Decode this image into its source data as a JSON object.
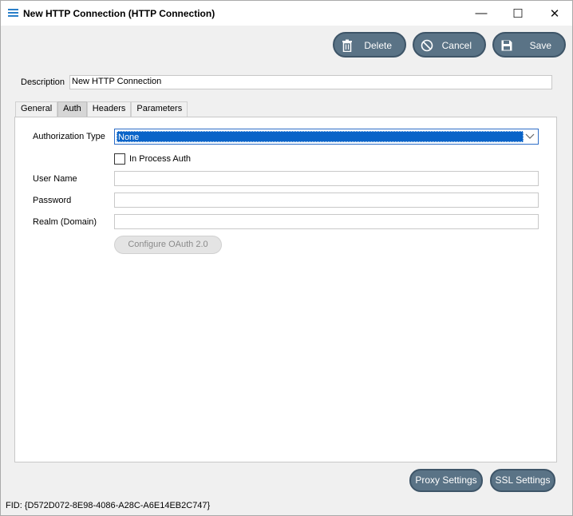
{
  "window": {
    "title": "New HTTP Connection (HTTP Connection)",
    "controls": {
      "minimize": "—",
      "maximize": "☐",
      "close": "✕"
    }
  },
  "toolbar": {
    "delete_label": "Delete",
    "cancel_label": "Cancel",
    "save_label": "Save"
  },
  "description": {
    "label": "Description",
    "value": "New HTTP Connection"
  },
  "tabs": [
    {
      "label": "General",
      "active": false
    },
    {
      "label": "Auth",
      "active": true
    },
    {
      "label": "Headers",
      "active": false
    },
    {
      "label": "Parameters",
      "active": false
    }
  ],
  "auth": {
    "authorization_type_label": "Authorization Type",
    "authorization_type_value": "None",
    "in_process_auth_label": "In Process Auth",
    "in_process_auth_checked": false,
    "user_name_label": "User Name",
    "user_name_value": "",
    "password_label": "Password",
    "password_value": "",
    "realm_label": "Realm (Domain)",
    "realm_value": "",
    "configure_oauth_label": "Configure OAuth 2.0"
  },
  "footer": {
    "proxy_settings_label": "Proxy Settings",
    "ssl_settings_label": "SSL Settings",
    "fid_text": "FID: {D572D072-8E98-4086-A28C-A6E14EB2C747}"
  },
  "colors": {
    "button_bg": "#5a7386",
    "selection": "#0a64c8",
    "app_icon": "#2a7fc9"
  }
}
